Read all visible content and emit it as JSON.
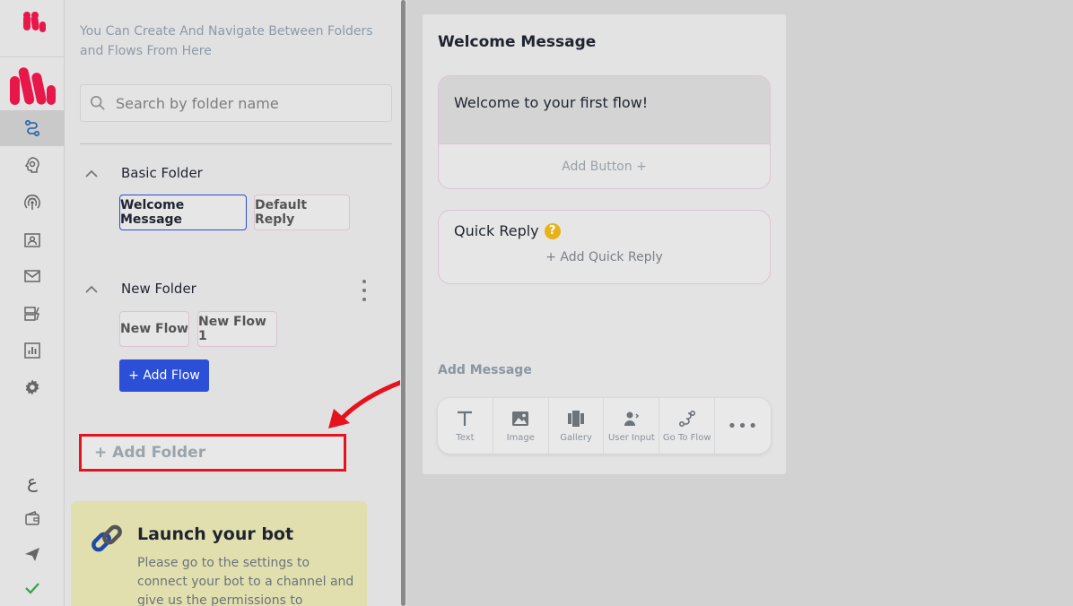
{
  "panel": {
    "hint": "You Can Create And Navigate Between Folders and Flows From Here",
    "search_placeholder": "Search by folder name",
    "folders": [
      {
        "name": "Basic Folder",
        "flows": [
          "Welcome Message",
          "Default Reply"
        ]
      },
      {
        "name": "New Folder",
        "flows": [
          "New Flow",
          "New Flow 1"
        ]
      }
    ],
    "add_flow_label": "+ Add Flow",
    "add_folder_label": "+ Add Folder"
  },
  "launch": {
    "title": "Launch your bot",
    "text": "Please go to the settings to connect your bot to a channel and give us the permissions to"
  },
  "editor": {
    "title": "Welcome Message",
    "message_text": "Welcome to your first flow!",
    "add_button_label": "Add Button +",
    "quick_reply_title": "Quick Reply",
    "help_glyph": "?",
    "add_quick_reply_label": "+ Add Quick Reply",
    "add_message_label": "Add Message",
    "tools": [
      {
        "label": "Text",
        "icon": "text-icon"
      },
      {
        "label": "Image",
        "icon": "image-icon"
      },
      {
        "label": "Gallery",
        "icon": "gallery-icon"
      },
      {
        "label": "User Input",
        "icon": "user-input-icon"
      },
      {
        "label": "Go To Flow",
        "icon": "go-to-flow-icon"
      }
    ],
    "more_glyph": "•••"
  },
  "rail": {
    "language_glyph": "ع",
    "colors": {
      "brand": "#e8174a",
      "active_icon": "#1d5fa8",
      "check": "#2aa64a"
    }
  }
}
